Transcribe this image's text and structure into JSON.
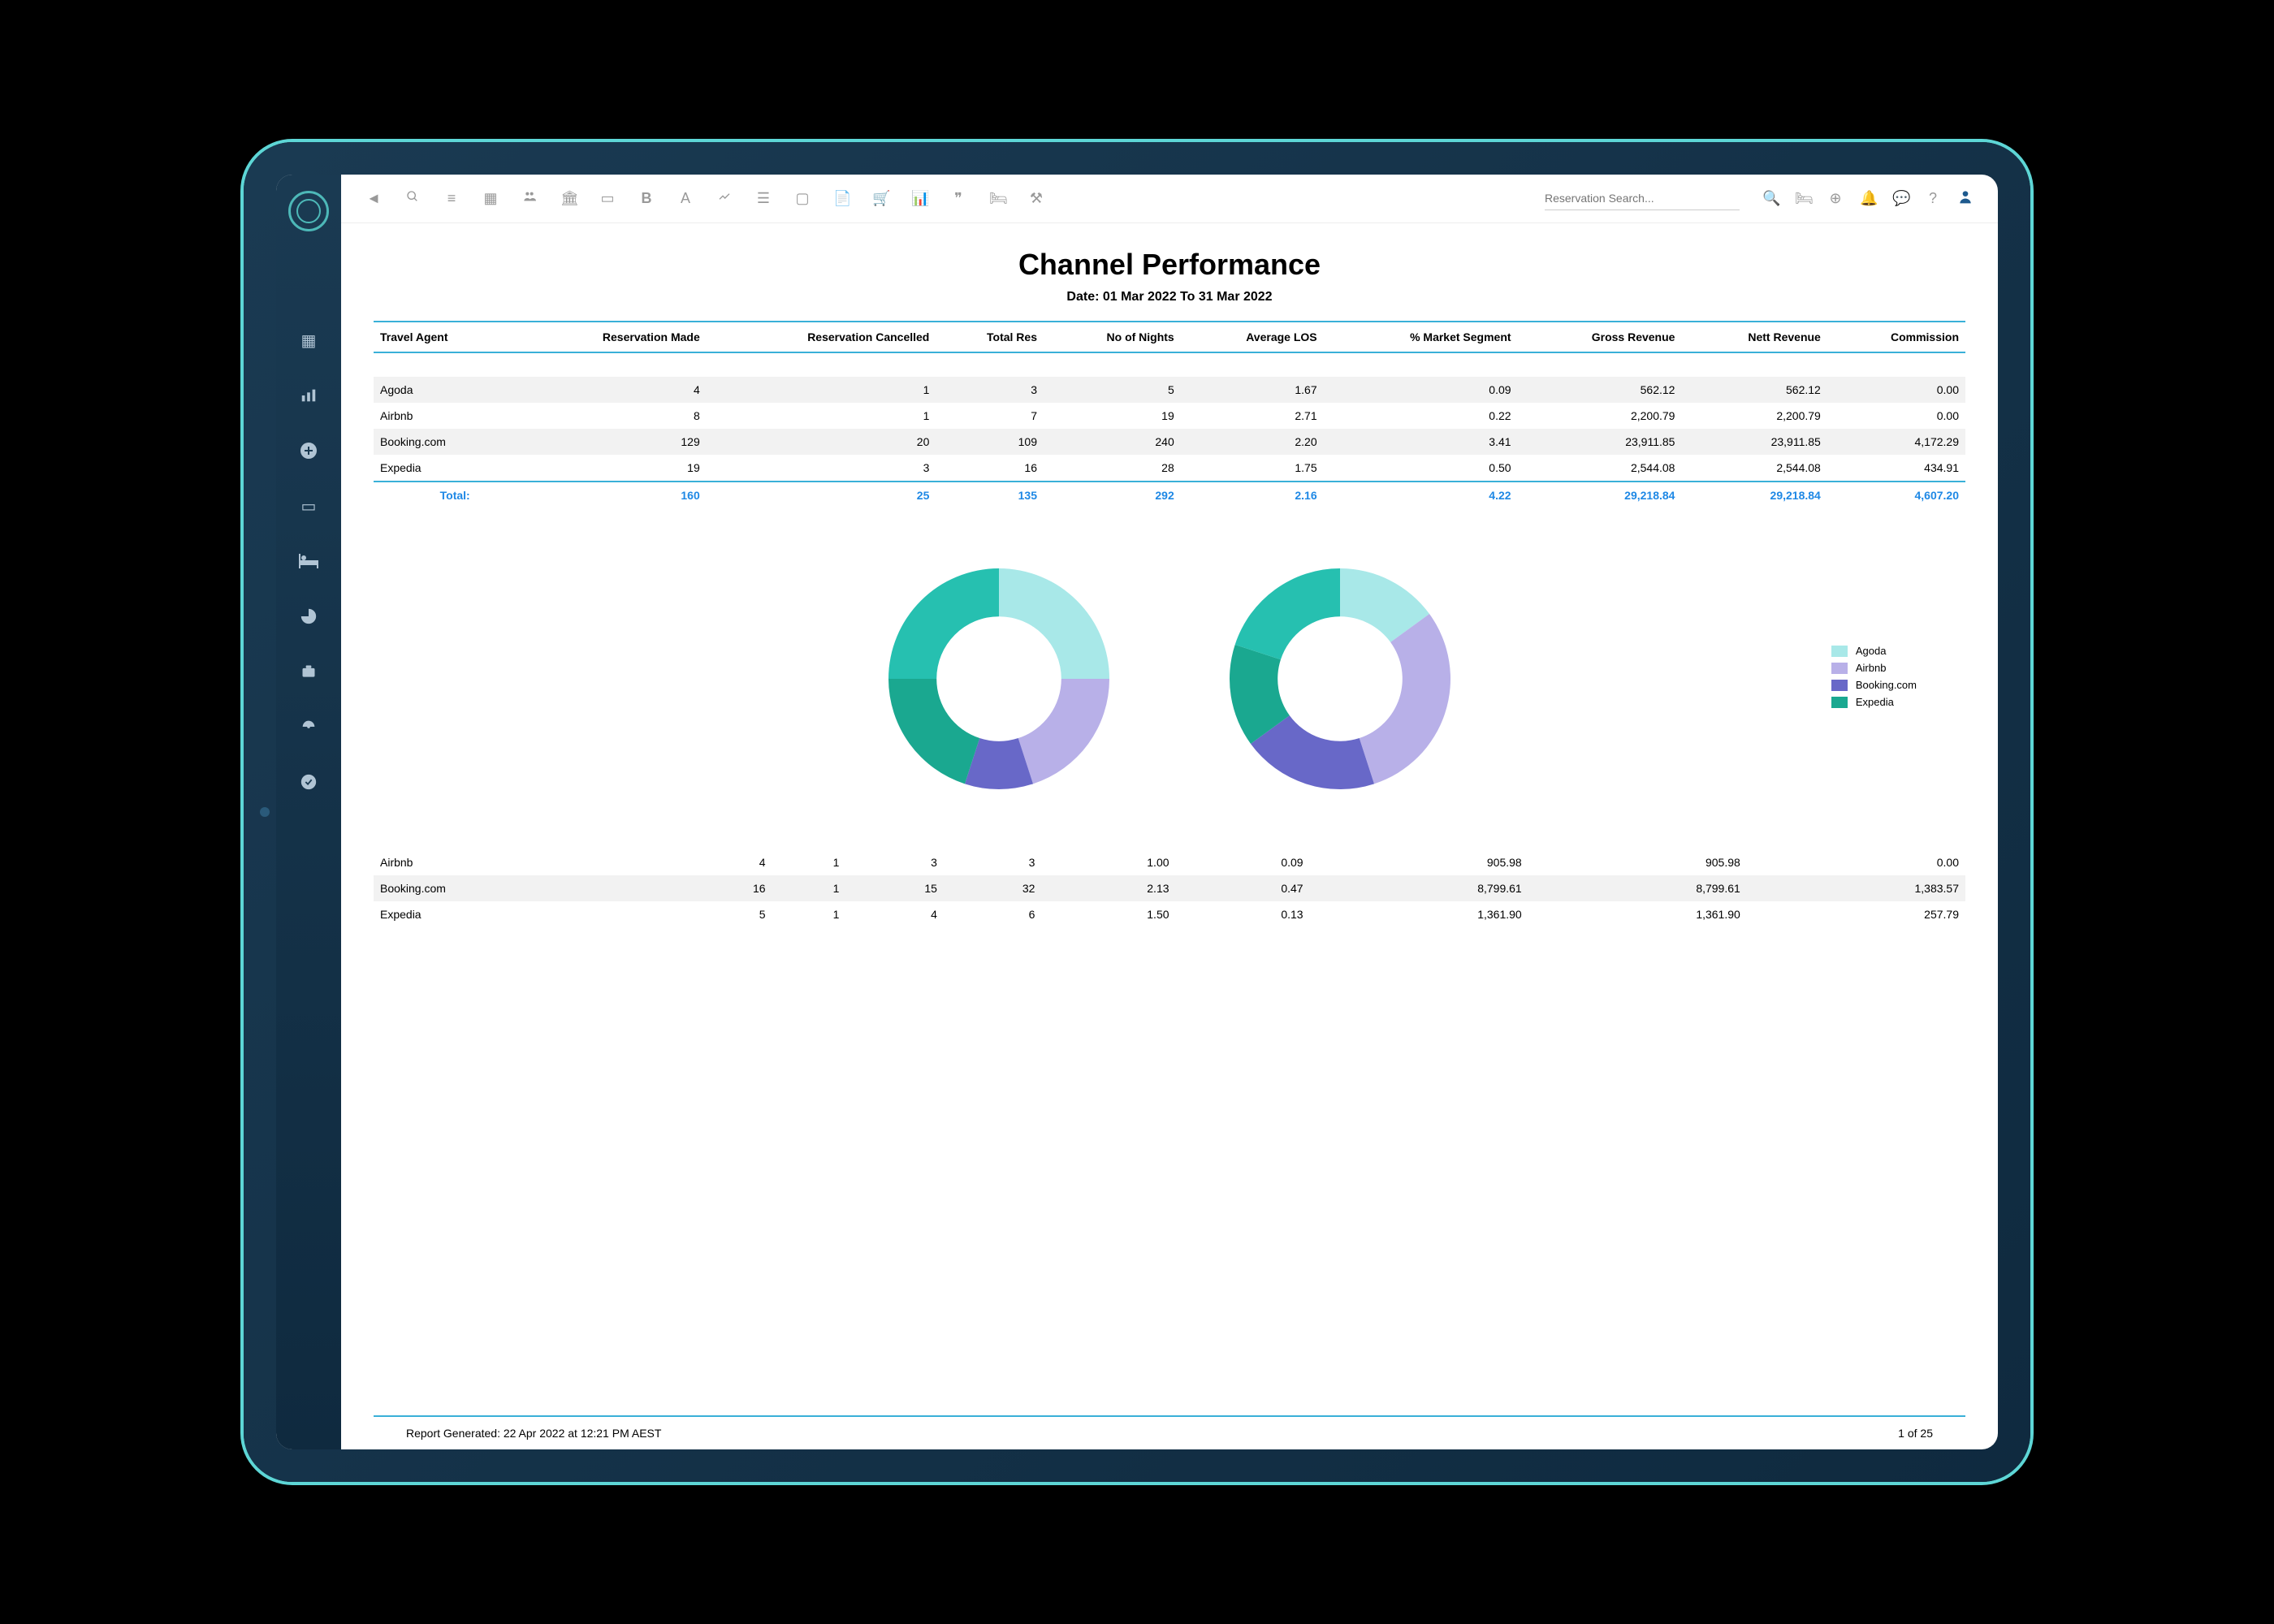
{
  "header": {
    "search_placeholder": "Reservation Search..."
  },
  "report": {
    "title": "Channel Performance",
    "date_range": "Date: 01 Mar 2022 To 31 Mar 2022"
  },
  "table1": {
    "headers": [
      "Travel Agent",
      "Reservation Made",
      "Reservation Cancelled",
      "Total Res",
      "No of Nights",
      "Average LOS",
      "% Market Segment",
      "Gross Revenue",
      "Nett Revenue",
      "Commission"
    ],
    "rows": [
      {
        "agent": "Agoda",
        "made": "4",
        "cancelled": "1",
        "total": "3",
        "nights": "5",
        "los": "1.67",
        "pct": "0.09",
        "gross": "562.12",
        "nett": "562.12",
        "comm": "0.00"
      },
      {
        "agent": "Airbnb",
        "made": "8",
        "cancelled": "1",
        "total": "7",
        "nights": "19",
        "los": "2.71",
        "pct": "0.22",
        "gross": "2,200.79",
        "nett": "2,200.79",
        "comm": "0.00"
      },
      {
        "agent": "Booking.com",
        "made": "129",
        "cancelled": "20",
        "total": "109",
        "nights": "240",
        "los": "2.20",
        "pct": "3.41",
        "gross": "23,911.85",
        "nett": "23,911.85",
        "comm": "4,172.29"
      },
      {
        "agent": "Expedia",
        "made": "19",
        "cancelled": "3",
        "total": "16",
        "nights": "28",
        "los": "1.75",
        "pct": "0.50",
        "gross": "2,544.08",
        "nett": "2,544.08",
        "comm": "434.91"
      }
    ],
    "total": {
      "label": "Total:",
      "made": "160",
      "cancelled": "25",
      "total": "135",
      "nights": "292",
      "los": "2.16",
      "pct": "4.22",
      "gross": "29,218.84",
      "nett": "29,218.84",
      "comm": "4,607.20"
    }
  },
  "table2": {
    "rows": [
      {
        "agent": "Airbnb",
        "made": "4",
        "cancelled": "1",
        "total": "3",
        "nights": "3",
        "los": "1.00",
        "pct": "0.09",
        "gross": "905.98",
        "nett": "905.98",
        "comm": "0.00"
      },
      {
        "agent": "Booking.com",
        "made": "16",
        "cancelled": "1",
        "total": "15",
        "nights": "32",
        "los": "2.13",
        "pct": "0.47",
        "gross": "8,799.61",
        "nett": "8,799.61",
        "comm": "1,383.57"
      },
      {
        "agent": "Expedia",
        "made": "5",
        "cancelled": "1",
        "total": "4",
        "nights": "6",
        "los": "1.50",
        "pct": "0.13",
        "gross": "1,361.90",
        "nett": "1,361.90",
        "comm": "257.79"
      }
    ]
  },
  "legend": [
    {
      "label": "Agoda",
      "color": "#a8e8e8"
    },
    {
      "label": "Airbnb",
      "color": "#b8b0e8"
    },
    {
      "label": "Booking.com",
      "color": "#6868c8"
    },
    {
      "label": "Expedia",
      "color": "#1aa890"
    }
  ],
  "footer": {
    "generated": "Report Generated: 22 Apr 2022 at 12:21 PM AEST",
    "page": "1 of 25"
  },
  "chart_data": [
    {
      "type": "pie",
      "title": "",
      "series": [
        {
          "name": "Agoda",
          "value": 25,
          "color": "#a8e8e8"
        },
        {
          "name": "Airbnb",
          "value": 20,
          "color": "#b8b0e8"
        },
        {
          "name": "Booking.com",
          "value": 10,
          "color": "#6868c8"
        },
        {
          "name": "Expedia dark",
          "value": 20,
          "color": "#1aa890"
        },
        {
          "name": "Expedia",
          "value": 25,
          "color": "#26c0b0"
        }
      ]
    },
    {
      "type": "pie",
      "title": "",
      "series": [
        {
          "name": "Agoda",
          "value": 15,
          "color": "#a8e8e8"
        },
        {
          "name": "Airbnb",
          "value": 30,
          "color": "#b8b0e8"
        },
        {
          "name": "Booking.com",
          "value": 20,
          "color": "#6868c8"
        },
        {
          "name": "Expedia dark",
          "value": 15,
          "color": "#1aa890"
        },
        {
          "name": "Expedia",
          "value": 20,
          "color": "#26c0b0"
        }
      ]
    }
  ]
}
